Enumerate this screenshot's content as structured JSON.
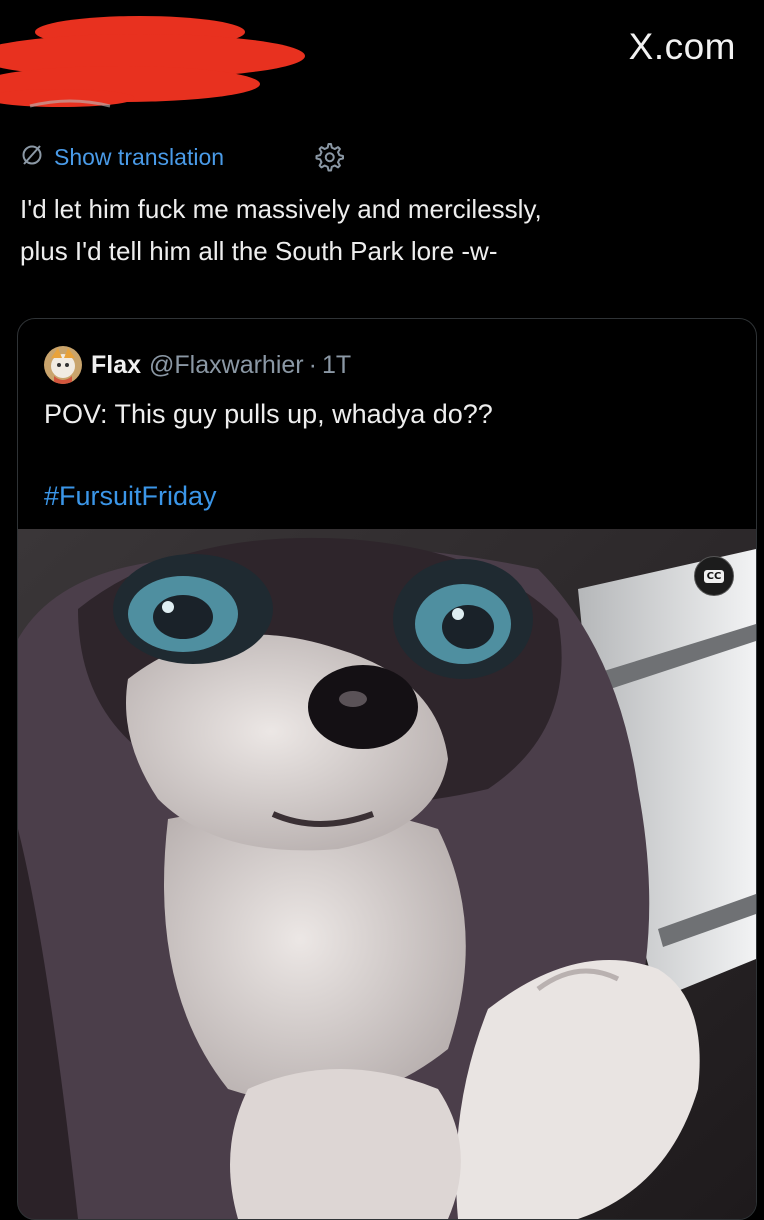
{
  "header": {
    "site": "X.com"
  },
  "tweet": {
    "translate_label": "Show translation",
    "text": "I'd let him fuck me massively and mercilessly,\nplus I'd tell him all the South Park lore -w-"
  },
  "quote": {
    "author_name": "Flax",
    "handle": "@Flaxwarhier",
    "separator": "·",
    "time": "1T",
    "text": "POV: This guy pulls up, whadya do??",
    "hashtag": "#FursuitFriday",
    "media": {
      "caption_button": "CC"
    }
  },
  "icons": {
    "translate": "translate-slash-icon",
    "settings": "gear-icon",
    "captions": "closed-captions-icon"
  },
  "colors": {
    "background": "#000000",
    "link": "#4a9be8",
    "hashtag": "#3b96e8",
    "muted": "#8b98a5",
    "redaction": "#e8311f"
  }
}
